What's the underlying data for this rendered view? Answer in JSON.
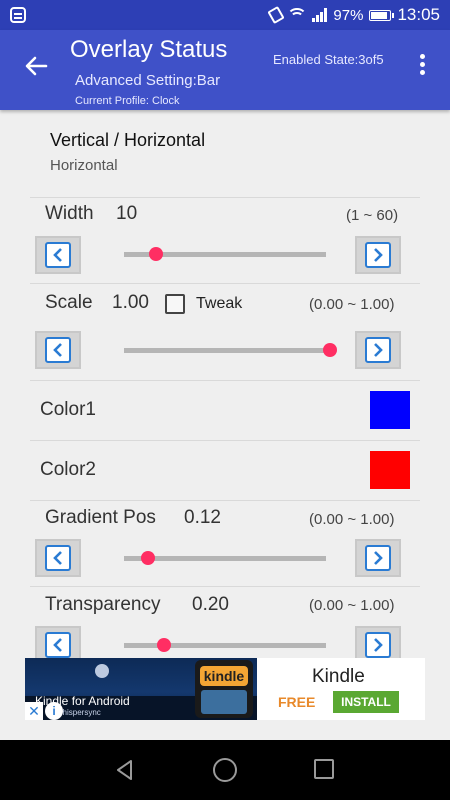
{
  "status_bar": {
    "battery": "97%",
    "time": "13:05",
    "left_icon": "notification-icon",
    "icons": [
      "vibrate-icon",
      "wifi-icon",
      "signal-icon",
      "battery-icon"
    ]
  },
  "app_bar": {
    "title": "Overlay Status",
    "subtitle": "Advanced Setting:Bar",
    "profile": "Current Profile: Clock",
    "enabled_state": "Enabled State:3of5",
    "back_icon": "arrow-back-icon",
    "menu_icon": "more-vert-icon"
  },
  "orientation": {
    "label": "Vertical / Horizontal",
    "value": "Horizontal"
  },
  "width": {
    "label": "Width",
    "value": "10",
    "range": "(1 ~ 60)",
    "level": 0.16
  },
  "scale": {
    "label": "Scale",
    "value": "1.00",
    "checkbox_label": "Tweak",
    "checked": false,
    "range": "(0.00 ~ 1.00)",
    "level": 1.0
  },
  "color1": {
    "label": "Color1",
    "color": "#0000ff"
  },
  "color2": {
    "label": "Color2",
    "color": "#ff0000"
  },
  "gradient": {
    "label": "Gradient Pos",
    "value": "0.12",
    "range": "(0.00 ~ 1.00)",
    "level": 0.12
  },
  "transparency": {
    "label": "Transparency",
    "value": "0.20",
    "range": "(0.00 ~ 1.00)",
    "level": 0.2
  },
  "ad": {
    "image_caption": "Kindle for Android",
    "image_sub": "Whispersync",
    "brand_badge": "kindle",
    "app_name": "Kindle",
    "price": "FREE",
    "install_label": "INSTALL"
  },
  "accent_colors": {
    "app_bar": "#3f51c8",
    "status_bar": "#2d3fb5",
    "slider_thumb": "#ff2e63",
    "step_arrow": "#2a7bd3"
  }
}
